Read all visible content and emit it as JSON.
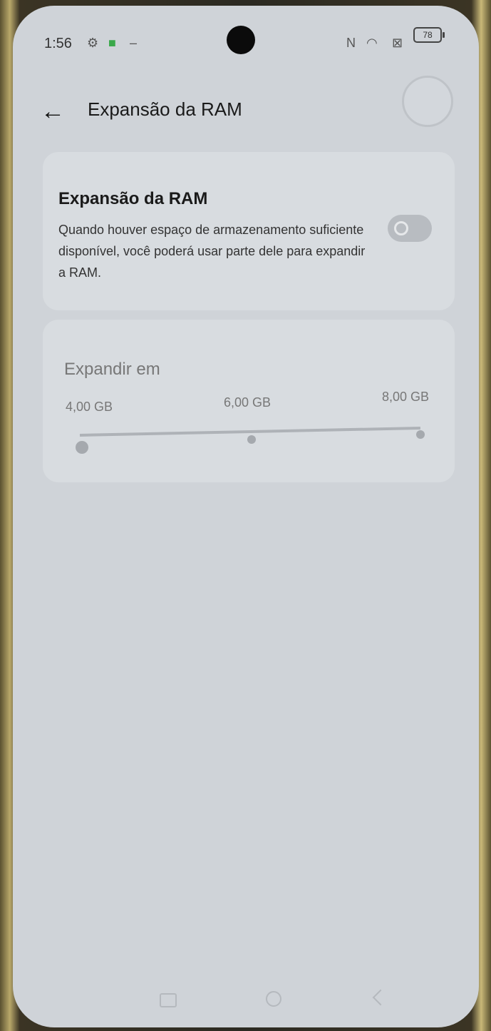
{
  "status_bar": {
    "time": "1:56",
    "battery": "78",
    "icons": [
      "settings-gear-icon",
      "app-notification-icon",
      "nfc-icon",
      "wifi-icon",
      "signal-x-icon",
      "battery-icon"
    ]
  },
  "header": {
    "title": "Expansão da RAM",
    "back_icon": "arrow-left-icon"
  },
  "ram_expansion_card": {
    "title": "Expansão da RAM",
    "description": "Quando houver espaço de armazenamento suficiente disponível, você poderá usar parte dele para expandir a RAM.",
    "toggle_state": "off"
  },
  "expand_card": {
    "title": "Expandir em",
    "options": [
      "4,00 GB",
      "6,00 GB",
      "8,00 GB"
    ],
    "selected_index": 0
  },
  "nav_bar": {
    "icons": [
      "recents-icon",
      "home-icon",
      "back-triangle-icon"
    ]
  }
}
